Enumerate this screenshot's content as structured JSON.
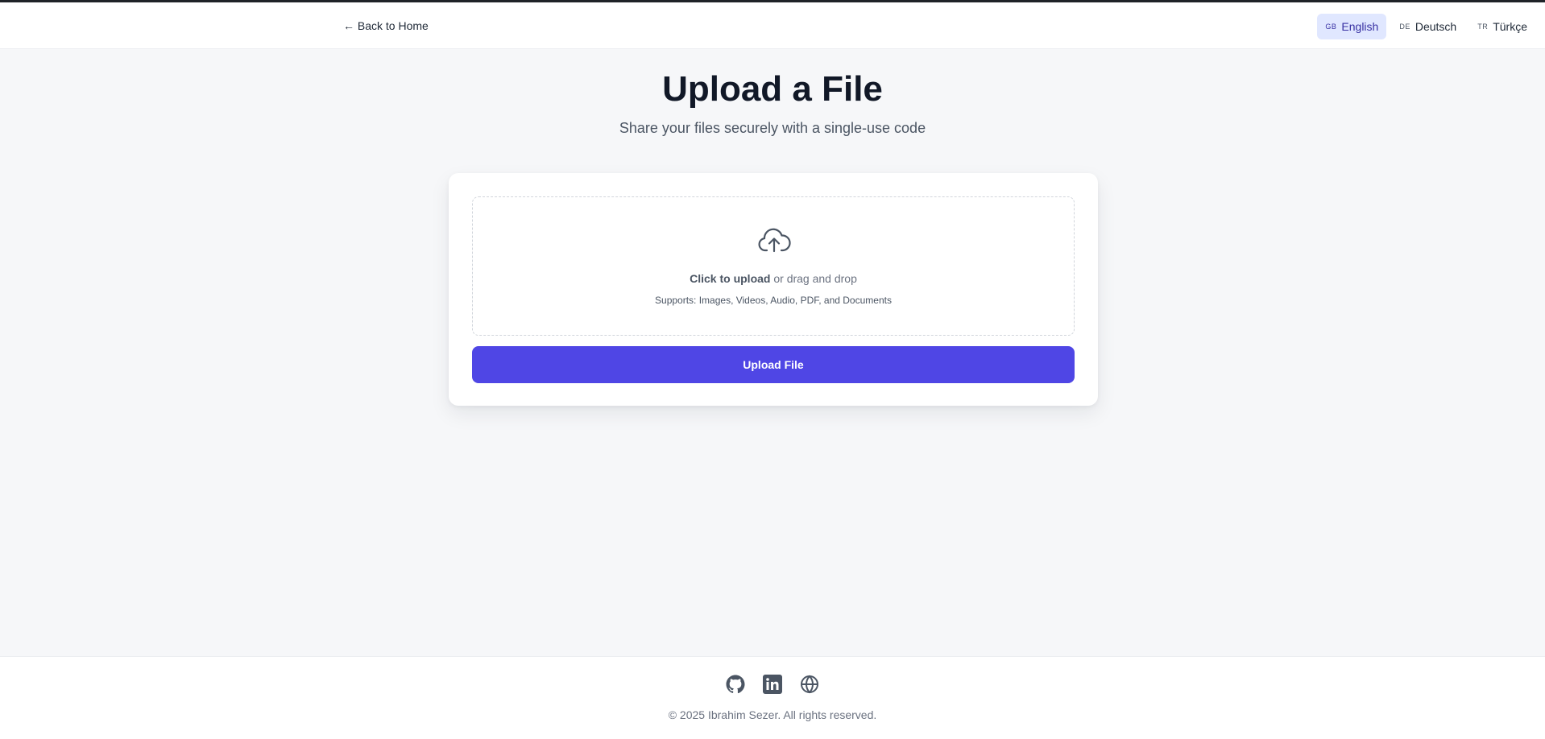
{
  "header": {
    "back_link": "← Back to Home",
    "languages": [
      {
        "code": "GB",
        "label": "English",
        "active": true
      },
      {
        "code": "DE",
        "label": "Deutsch",
        "active": false
      },
      {
        "code": "TR",
        "label": "Türkçe",
        "active": false
      }
    ]
  },
  "main": {
    "title": "Upload a File",
    "subtitle": "Share your files securely with a single-use code",
    "dropzone": {
      "icon": "cloud-upload-icon",
      "click_text": "Click to upload",
      "drag_text": " or drag and drop",
      "supports_text": "Supports: Images, Videos, Audio, PDF, and Documents"
    },
    "upload_button": "Upload File"
  },
  "footer": {
    "icons": [
      "github-icon",
      "linkedin-icon",
      "globe-icon"
    ],
    "copyright": "© 2025 Ibrahim Sezer. All rights reserved."
  },
  "colors": {
    "primary": "#4f46e5",
    "active_language_bg": "#e0e7ff",
    "background": "#f6f7f9"
  }
}
